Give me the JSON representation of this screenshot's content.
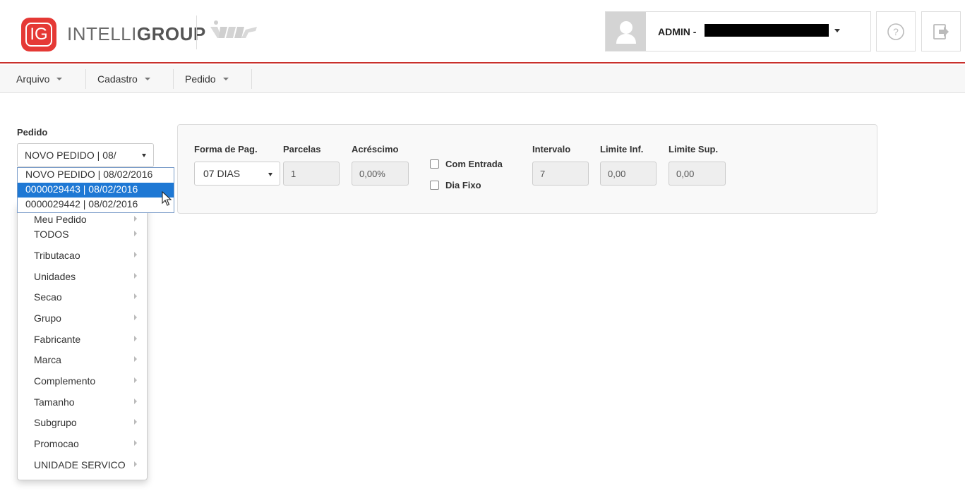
{
  "header": {
    "logo_badge": "IG",
    "brand_light": "INTELLI",
    "brand_bold": "GROUP",
    "user_label": "ADMIN -"
  },
  "menubar": {
    "items": [
      {
        "label": "Arquivo"
      },
      {
        "label": "Cadastro"
      },
      {
        "label": "Pedido"
      }
    ]
  },
  "pedido": {
    "label": "Pedido",
    "selected_display": "NOVO PEDIDO | 08/",
    "options": [
      {
        "label": "NOVO PEDIDO | 08/02/2016"
      },
      {
        "label": "0000029443 | 08/02/2016"
      },
      {
        "label": "0000029442 | 08/02/2016"
      }
    ]
  },
  "side_menu": {
    "items": [
      {
        "label": "Meu Pedido"
      },
      {
        "label": "TODOS"
      },
      {
        "label": "Tributacao"
      },
      {
        "label": "Unidades"
      },
      {
        "label": "Secao"
      },
      {
        "label": "Grupo"
      },
      {
        "label": "Fabricante"
      },
      {
        "label": "Marca"
      },
      {
        "label": "Complemento"
      },
      {
        "label": "Tamanho"
      },
      {
        "label": "Subgrupo"
      },
      {
        "label": "Promocao"
      },
      {
        "label": "UNIDADE SERVICO"
      }
    ]
  },
  "payment": {
    "forma_label": "Forma de Pag.",
    "forma_value": "07 DIAS",
    "parcelas_label": "Parcelas",
    "parcelas_value": "1",
    "acrescimo_label": "Acréscimo",
    "acrescimo_value": "0,00%",
    "com_entrada_label": "Com Entrada",
    "dia_fixo_label": "Dia Fixo",
    "intervalo_label": "Intervalo",
    "intervalo_value": "7",
    "limite_inf_label": "Limite Inf.",
    "limite_inf_value": "0,00",
    "limite_sup_label": "Limite Sup.",
    "limite_sup_value": "0,00"
  },
  "colors": {
    "brand_red": "#e53935",
    "header_line": "#c9302c",
    "selection_blue": "#1e78d4"
  }
}
